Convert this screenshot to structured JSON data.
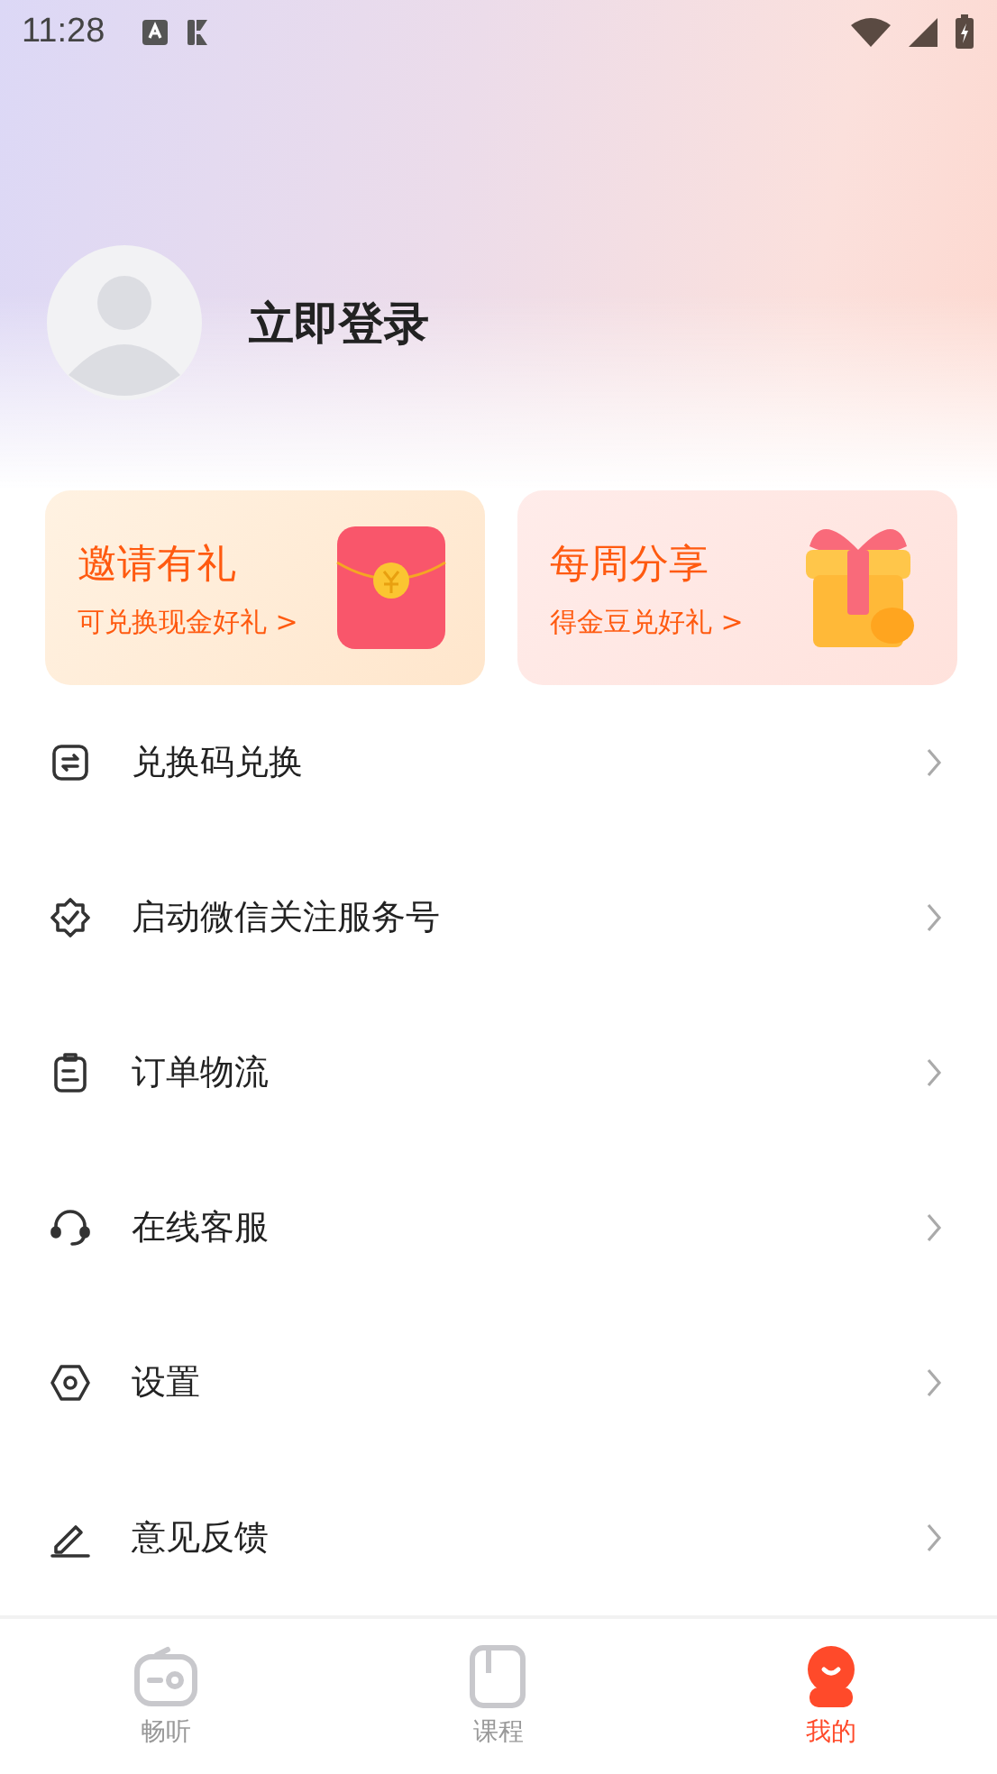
{
  "status_bar": {
    "time": "11:28"
  },
  "profile": {
    "login": "立即登录"
  },
  "promo_cards": [
    {
      "title": "邀请有礼",
      "subtitle": "可兑换现金好礼 >"
    },
    {
      "title": "每周分享",
      "subtitle": "得金豆兑好礼 >"
    }
  ],
  "menu": [
    {
      "label": "兑换码兑换"
    },
    {
      "label": "启动微信关注服务号"
    },
    {
      "label": "订单物流"
    },
    {
      "label": "在线客服"
    },
    {
      "label": "设置"
    },
    {
      "label": "意见反馈"
    }
  ],
  "tabs": [
    {
      "label": "畅听",
      "selected": false
    },
    {
      "label": "课程",
      "selected": false
    },
    {
      "label": "我的",
      "selected": true
    }
  ]
}
